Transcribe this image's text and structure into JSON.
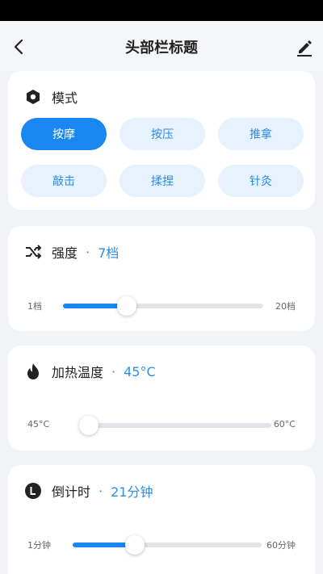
{
  "header": {
    "title": "头部栏标题"
  },
  "mode": {
    "label": "模式",
    "options": [
      "按摩",
      "按压",
      "推拿",
      "敲击",
      "揉捏",
      "针灸"
    ],
    "selected": "按摩"
  },
  "strength": {
    "label": "强度",
    "value_text": "7档",
    "min_label": "1档",
    "max_label": "20档",
    "level": 0.32
  },
  "heat": {
    "label": "加热温度",
    "value_text": "45°C",
    "min_label": "45°C",
    "max_label": "60°C",
    "level": 0.0
  },
  "timer": {
    "label": "倒计时",
    "value_text": "21分钟",
    "min_label": "1分钟",
    "max_label": "60分钟",
    "level": 0.33
  },
  "colors": {
    "accent": "#1a87f0",
    "chip_bg": "#e6f2fd",
    "track": "#e3e4e8"
  },
  "icons": {
    "back": "back-arrow-icon",
    "edit": "pencil-icon",
    "mode": "hexagon-icon",
    "strength": "shuffle-icon",
    "heat": "flame-icon",
    "timer": "clock-icon"
  }
}
